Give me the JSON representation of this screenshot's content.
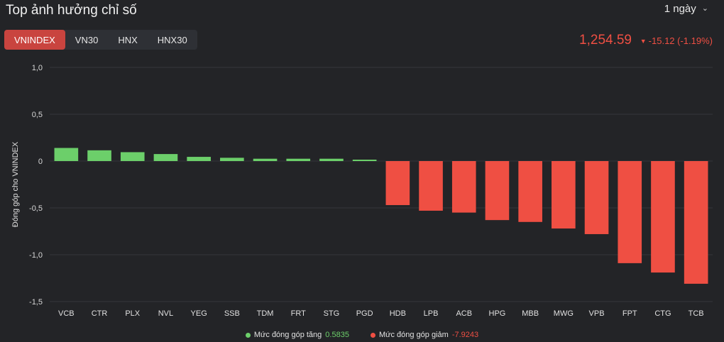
{
  "header": {
    "title": "Top ảnh hưởng chỉ số",
    "period_label": "1 ngày",
    "tabs": [
      {
        "label": "VNINDEX",
        "active": true
      },
      {
        "label": "VN30",
        "active": false
      },
      {
        "label": "HNX",
        "active": false
      },
      {
        "label": "HNX30",
        "active": false
      }
    ],
    "index_value": "1,254.59",
    "index_change": "-15.12 (-1.19%)"
  },
  "colors": {
    "up": "#6ccf6a",
    "down": "#ef4f43",
    "accent": "#c9443f",
    "background": "#232427"
  },
  "chart_data": {
    "type": "bar",
    "ylabel": "Đóng góp cho VNINDEX",
    "xlabel": "",
    "ylim": [
      -1.5,
      1.0
    ],
    "yticks": [
      1.0,
      0.5,
      0,
      -0.5,
      -1.0,
      -1.5
    ],
    "ytick_labels": [
      "1,0",
      "0,5",
      "0",
      "-0,5",
      "-1,0",
      "-1,5"
    ],
    "grid": true,
    "categories": [
      "VCB",
      "CTR",
      "PLX",
      "NVL",
      "YEG",
      "SSB",
      "TDM",
      "FRT",
      "STG",
      "PGD",
      "HDB",
      "LPB",
      "ACB",
      "HPG",
      "MBB",
      "MWG",
      "VPB",
      "FPT",
      "CTG",
      "TCB"
    ],
    "values": [
      0.14,
      0.115,
      0.095,
      0.075,
      0.045,
      0.035,
      0.025,
      0.025,
      0.025,
      0.015,
      -0.47,
      -0.53,
      -0.55,
      -0.63,
      -0.65,
      -0.72,
      -0.78,
      -1.09,
      -1.19,
      -1.31
    ]
  },
  "legend": {
    "up_label": "Mức đóng góp tăng",
    "up_value": "0.5835",
    "down_label": "Mức đóng góp giảm",
    "down_value": "-7.9243"
  }
}
